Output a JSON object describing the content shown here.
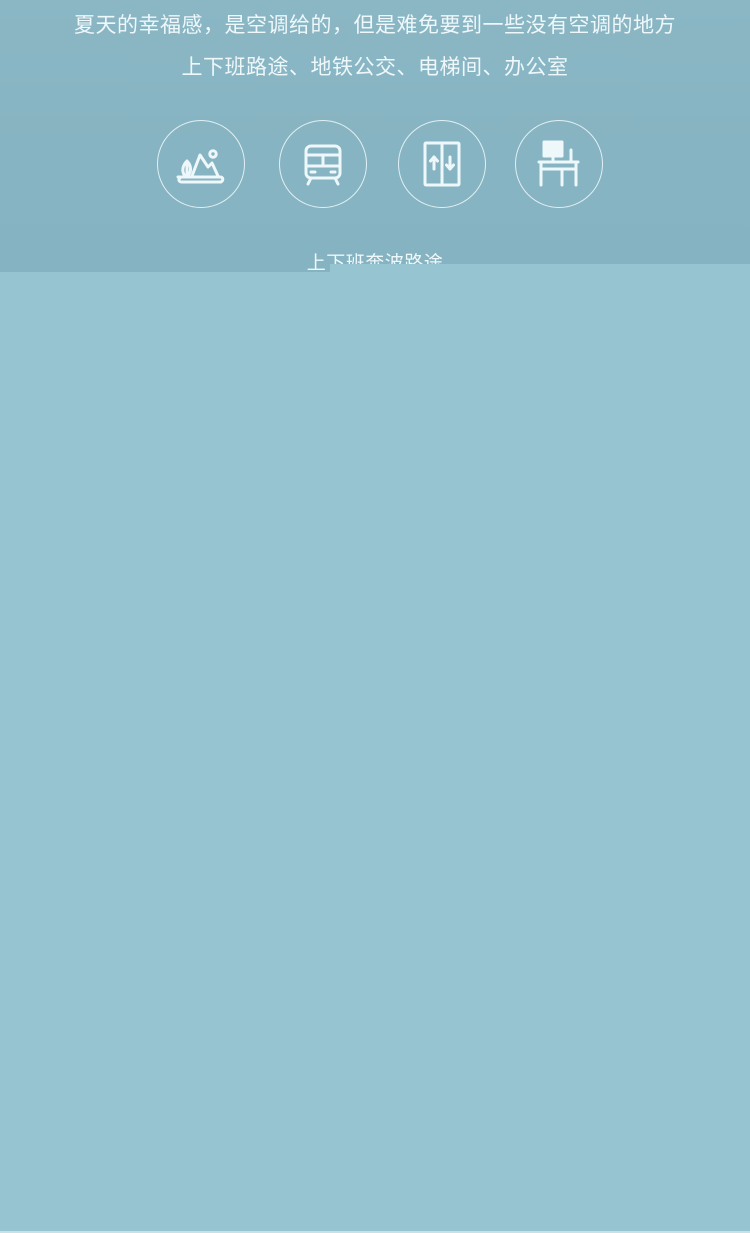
{
  "hero": {
    "line1": "夏天的幸福感，是空调给的，但是难免要到一些没有空调的地方",
    "line2": "上下班路途、地铁公交、电梯间、办公室",
    "icons": [
      {
        "name": "mountain-outdoor-icon"
      },
      {
        "name": "subway-train-icon"
      },
      {
        "name": "elevator-icon"
      },
      {
        "name": "office-desk-icon"
      }
    ],
    "caption": "上下班奔波路途"
  },
  "colors": {
    "hero_bg": "#8bb7c5",
    "page_bg": "#97c4d1",
    "text": "#eef7fa"
  }
}
